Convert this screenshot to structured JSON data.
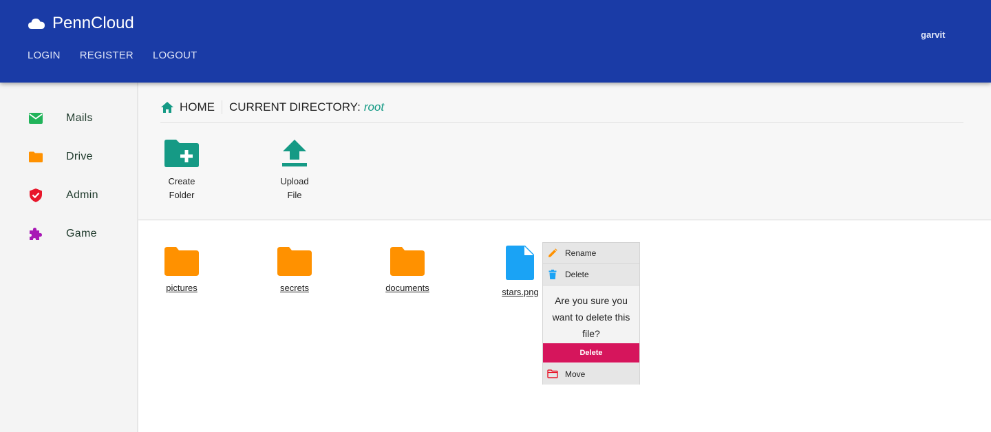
{
  "app": {
    "name": "PennCloud",
    "logo_icon": "cloud-icon"
  },
  "nav": {
    "login": "LOGIN",
    "register": "REGISTER",
    "logout": "LOGOUT"
  },
  "user": {
    "name": "garvit"
  },
  "sidebar": {
    "items": [
      {
        "label": "Mails",
        "icon": "mail-icon",
        "color": "#21b35a"
      },
      {
        "label": "Drive",
        "icon": "folder-icon",
        "color": "#ff9100"
      },
      {
        "label": "Admin",
        "icon": "shield-icon",
        "color": "#e8162a"
      },
      {
        "label": "Game",
        "icon": "puzzle-icon",
        "color": "#a818b5"
      }
    ]
  },
  "breadcrumb": {
    "home": "HOME",
    "dir_label": "CURRENT DIRECTORY:",
    "dir_value": "root"
  },
  "actions": {
    "create_folder": {
      "line1": "Create",
      "line2": "Folder",
      "icon": "create-folder-icon"
    },
    "upload_file": {
      "line1": "Upload",
      "line2": "File",
      "icon": "upload-icon"
    }
  },
  "files": [
    {
      "name": "pictures",
      "type": "folder"
    },
    {
      "name": "secrets",
      "type": "folder"
    },
    {
      "name": "documents",
      "type": "folder"
    },
    {
      "name": "stars.png",
      "type": "file"
    }
  ],
  "context_menu": {
    "rename": "Rename",
    "delete": "Delete",
    "confirm_text": "Are you sure you want to delete this file?",
    "confirm_button": "Delete",
    "move": "Move"
  },
  "colors": {
    "header": "#1a3ba6",
    "accent": "#159a85",
    "folder": "#ff9100",
    "file": "#1aa3f5",
    "danger": "#d6155c"
  }
}
